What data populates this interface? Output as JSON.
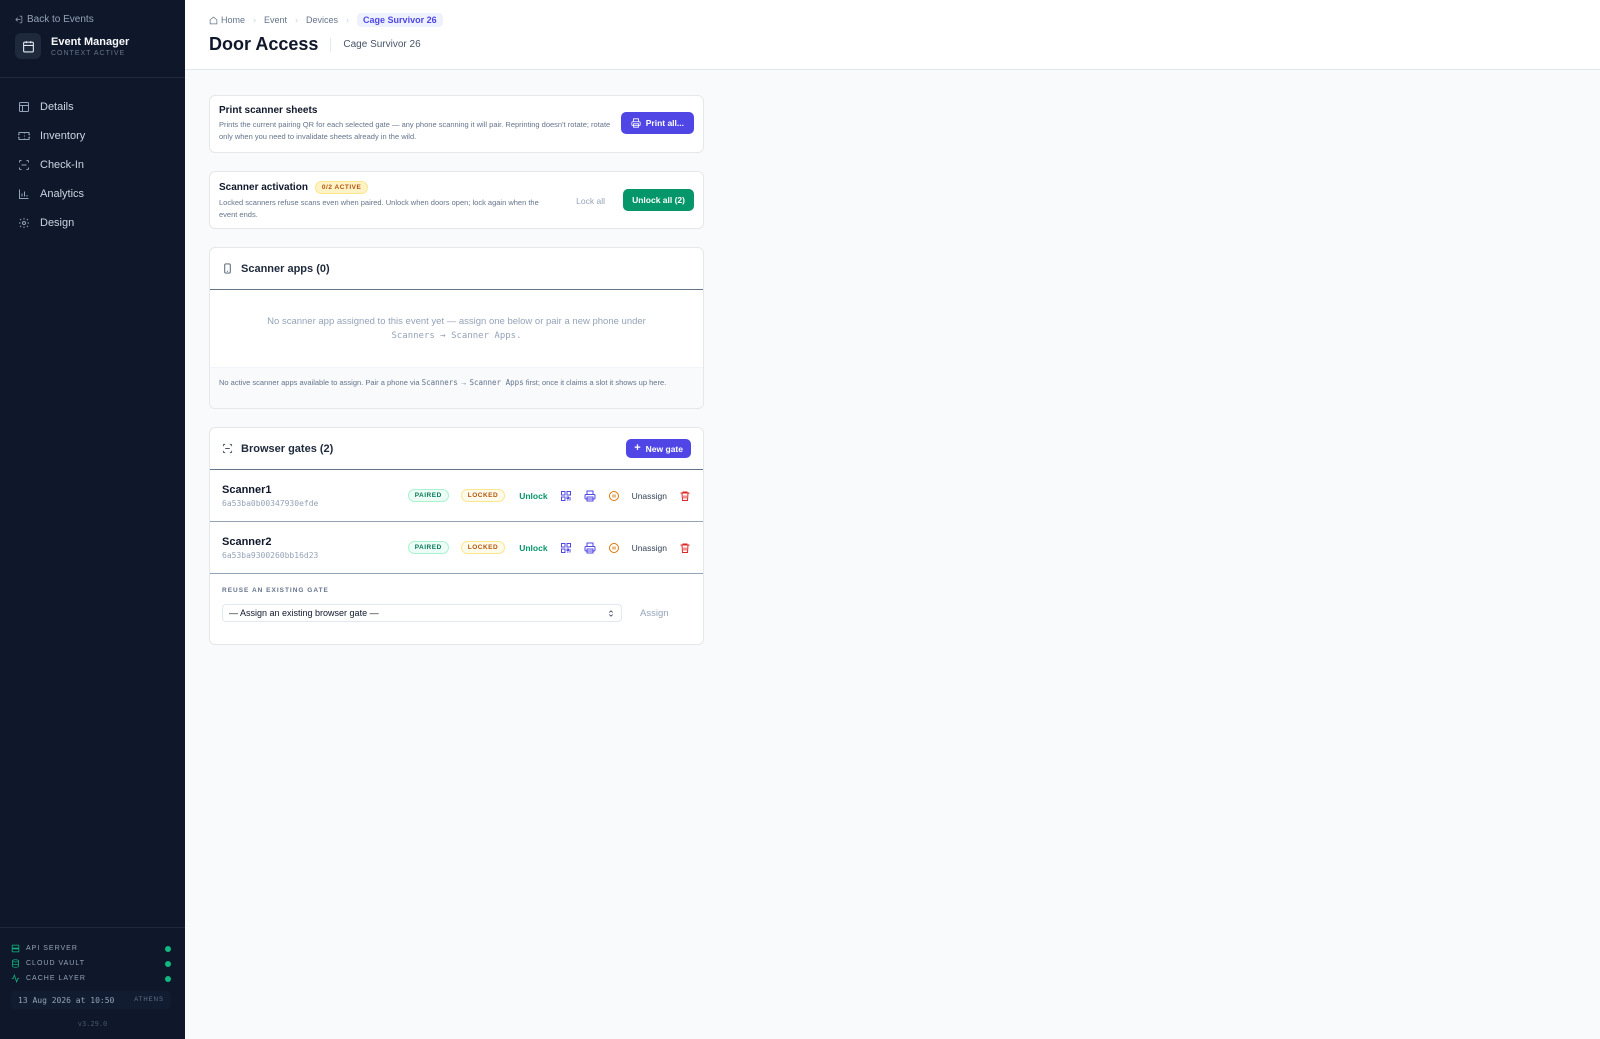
{
  "sidebar": {
    "back_label": "Back to Events",
    "brand_title": "Event Manager",
    "brand_sub": "CONTEXT ACTIVE",
    "nav": [
      {
        "label": "Details",
        "icon": "layout-icon"
      },
      {
        "label": "Inventory",
        "icon": "ticket-icon"
      },
      {
        "label": "Check-In",
        "icon": "scan-icon"
      },
      {
        "label": "Analytics",
        "icon": "bar-chart-icon"
      },
      {
        "label": "Design",
        "icon": "gear-icon"
      }
    ],
    "status": [
      {
        "label": "API SERVER",
        "icon": "server-icon",
        "color": "#10b981"
      },
      {
        "label": "CLOUD VAULT",
        "icon": "database-icon",
        "color": "#10b981"
      },
      {
        "label": "CACHE LAYER",
        "icon": "activity-icon",
        "color": "#10b981"
      }
    ],
    "clock_time": "13 Aug 2026 at 10:50",
    "clock_city": "ATHENS",
    "version": "v3.29.0"
  },
  "header": {
    "breadcrumbs": [
      "Home",
      "Event",
      "Devices",
      "Cage Survivor 26"
    ],
    "title": "Door Access",
    "subtitle": "Cage Survivor 26"
  },
  "print_card": {
    "title": "Print scanner sheets",
    "desc": "Prints the current pairing QR for each selected gate — any phone scanning it will pair. Reprinting doesn't rotate; rotate only when you need to invalidate sheets already in the wild.",
    "button": "Print all..."
  },
  "activation_card": {
    "title": "Scanner activation",
    "badge": "0/2 ACTIVE",
    "desc": "Locked scanners refuse scans even when paired. Unlock when doors open; lock again when the event ends.",
    "lock_all": "Lock all",
    "unlock_all": "Unlock all (2)"
  },
  "scanner_apps": {
    "title": "Scanner apps (0)",
    "empty_text": "No scanner app assigned to this event yet — assign one below or pair a new phone under",
    "empty_path": "Scanners → Scanner Apps.",
    "footer_prefix": "No active scanner apps available to assign. Pair a phone via",
    "footer_path1": "Scanners",
    "footer_arrow": "→",
    "footer_path2": "Scanner Apps",
    "footer_suffix": "first; once it claims a slot it shows up here."
  },
  "browser_gates": {
    "title": "Browser gates (2)",
    "new_button": "New gate",
    "gates": [
      {
        "name": "Scanner1",
        "id": "6a53ba0b00347930efde",
        "paired": "PAIRED",
        "locked": "LOCKED",
        "unlock": "Unlock",
        "unassign": "Unassign"
      },
      {
        "name": "Scanner2",
        "id": "6a53ba9300260bb16d23",
        "paired": "PAIRED",
        "locked": "LOCKED",
        "unlock": "Unlock",
        "unassign": "Unassign"
      }
    ],
    "reuse_label": "REUSE AN EXISTING GATE",
    "select_value": "— Assign an existing browser gate —",
    "assign_button": "Assign"
  },
  "colors": {
    "sidebar_bg": "#0f172a",
    "accent": "#4f46e5",
    "success": "#059669",
    "danger": "#dc2626",
    "warning": "#d97706"
  }
}
